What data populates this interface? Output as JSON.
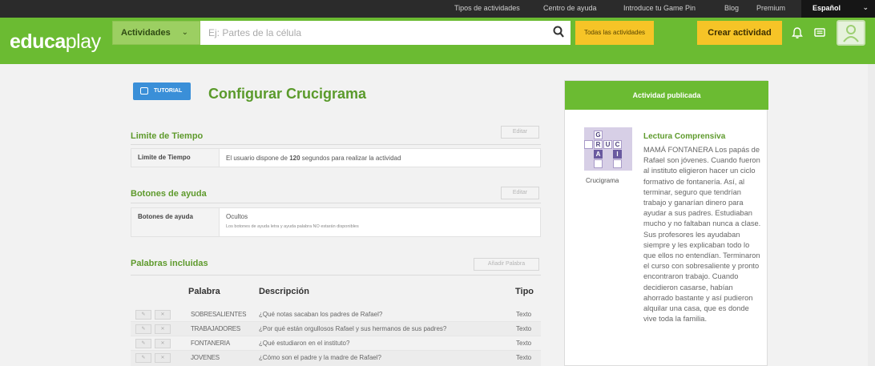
{
  "topbar": {
    "links": [
      "Tipos de actividades",
      "Centro de ayuda",
      "Introduce tu Game Pin",
      "Blog",
      "Premium"
    ],
    "language": "Español"
  },
  "header": {
    "logo_a": "educa",
    "logo_b": "play",
    "category": "Actividades",
    "search_placeholder": "Ej: Partes de la célula",
    "all_activities": "Todas las actividades",
    "create_activity": "Crear actividad"
  },
  "main": {
    "tutorial_label": "TUTORIAL",
    "title": "Configurar Crucigrama",
    "time_section": {
      "title": "Limite de Tiempo",
      "edit": "Editar",
      "key": "Limite de Tiempo",
      "value_pre": "El usuario dispone de",
      "value_num": "120",
      "value_post": "segundos para realizar la actividad"
    },
    "help_section": {
      "title": "Botones de ayuda",
      "edit": "Editar",
      "key": "Botones de ayuda",
      "value": "Ocultos",
      "note": "Los botones de ayuda letra y ayuda palabra NO estarán disponibles"
    },
    "words_section": {
      "title": "Palabras incluidas",
      "add": "Añadir Palabra",
      "headers": {
        "word": "Palabra",
        "desc": "Descripción",
        "type": "Tipo"
      },
      "rows": [
        {
          "word": "SOBRESALIENTES",
          "desc": "¿Qué notas sacaban los padres de Rafael?",
          "type": "Texto"
        },
        {
          "word": "TRABAJADORES",
          "desc": "¿Por qué están orgullosos Rafael y sus hermanos de sus padres?",
          "type": "Texto"
        },
        {
          "word": "FONTANERIA",
          "desc": "¿Qué estudiaron en el instituto?",
          "type": "Texto"
        },
        {
          "word": "JOVENES",
          "desc": "¿Cómo son el padre y la madre de Rafael?",
          "type": "Texto"
        }
      ]
    }
  },
  "card": {
    "header": "Actividad publicada",
    "thumb_letters": [
      "G",
      "R",
      "U",
      "C",
      "A",
      "I"
    ],
    "thumb_label": "Crucigrama",
    "title": "Lectura Comprensiva",
    "text": "MAMÁ FONTANERA Los papás de Rafael son jóvenes. Cuando fueron al instituto eligieron hacer un ciclo formativo de fontanería. Así, al terminar, seguro que tendrían trabajo y ganarían dinero para ayudar a sus padres. Estudiaban mucho y no faltaban nunca a clase. Sus profesores les ayudaban siempre y les explicaban todo lo que ellos no entendían. Terminaron el curso con sobresaliente y pronto encontraron trabajo. Cuando decidieron casarse, habían ahorrado bastante y así pudieron alquilar una casa, que es donde vive toda la familia."
  }
}
